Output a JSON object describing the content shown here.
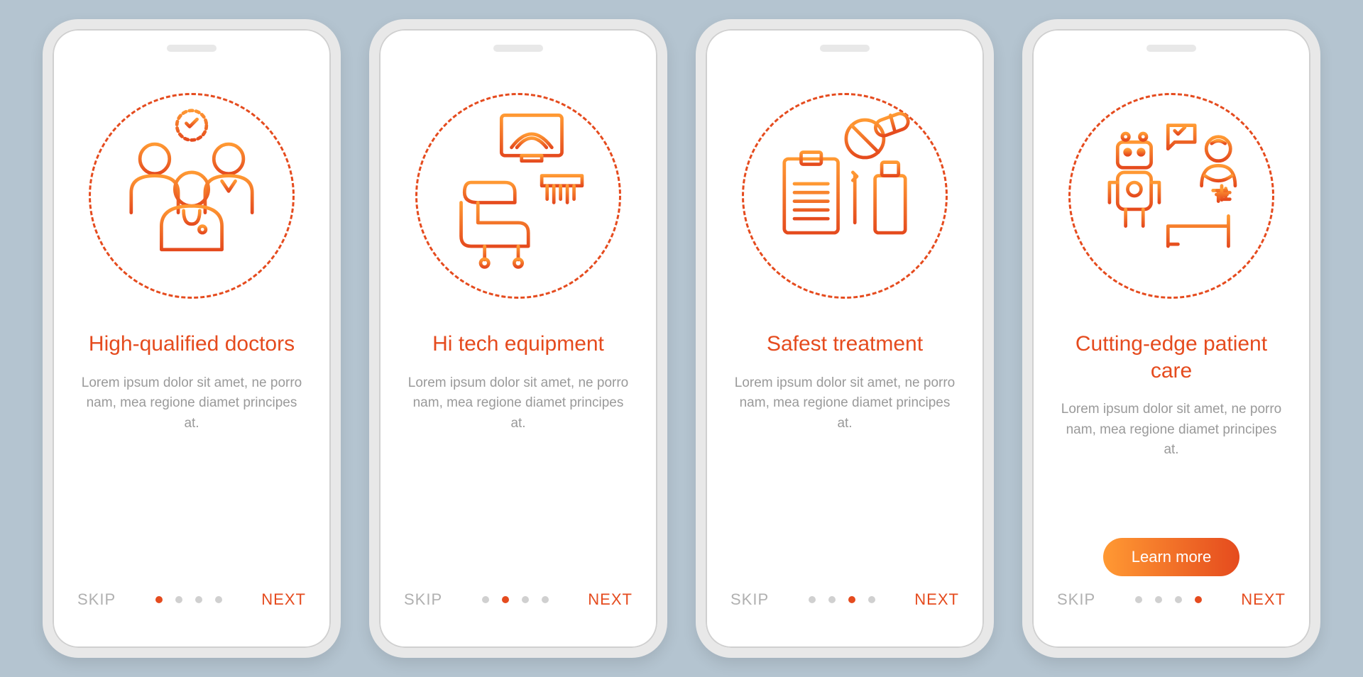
{
  "common": {
    "skip_label": "SKIP",
    "next_label": "NEXT",
    "description": "Lorem ipsum dolor sit amet, ne porro nam, mea regione diamet principes at.",
    "learn_more_label": "Learn more"
  },
  "screens": [
    {
      "title": "High-qualified doctors",
      "active_dot": 0,
      "illustration": "doctors",
      "has_button": false
    },
    {
      "title": "Hi tech equipment",
      "active_dot": 1,
      "illustration": "equipment",
      "has_button": false
    },
    {
      "title": "Safest treatment",
      "active_dot": 2,
      "illustration": "treatment",
      "has_button": false
    },
    {
      "title": "Cutting-edge patient care",
      "active_dot": 3,
      "illustration": "patient-care",
      "has_button": true
    }
  ]
}
